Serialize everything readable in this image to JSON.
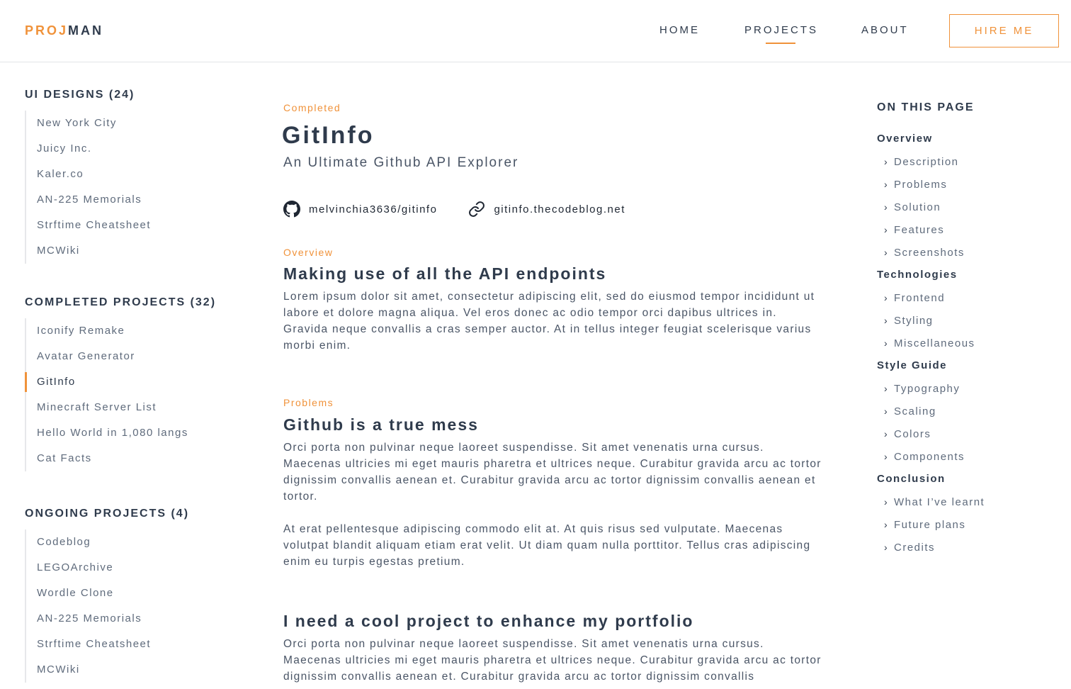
{
  "header": {
    "logo_accent": "PROJ",
    "logo_rest": "MAN",
    "nav": [
      {
        "label": "HOME"
      },
      {
        "label": "PROJECTS"
      },
      {
        "label": "ABOUT"
      }
    ],
    "active_nav": "PROJECTS",
    "hire_label": "HIRE ME"
  },
  "colors": {
    "accent": "#f0923a",
    "text_dark": "#2f3b4c",
    "text_muted": "#5f6b7c"
  },
  "sidebar": {
    "sections": [
      {
        "heading": "UI DESIGNS (24)",
        "items": [
          "New York City",
          "Juicy Inc.",
          "Kaler.co",
          "AN-225 Memorials",
          "Strftime Cheatsheet",
          "MCWiki"
        ]
      },
      {
        "heading": "COMPLETED PROJECTS (32)",
        "items": [
          "Iconify Remake",
          "Avatar Generator",
          "GitInfo",
          "Minecraft Server List",
          "Hello World in 1,080 langs",
          "Cat Facts"
        ]
      },
      {
        "heading": "ONGOING PROJECTS (4)",
        "items": [
          "Codeblog",
          "LEGOArchive",
          "Wordle Clone",
          "AN-225 Memorials",
          "Strftime Cheatsheet",
          "MCWiki"
        ]
      }
    ],
    "active_item": "GitInfo"
  },
  "main": {
    "status": "Completed",
    "title": "GitInfo",
    "subtitle": "An Ultimate Github API Explorer",
    "links": [
      {
        "icon": "github-icon",
        "label": "melvinchia3636/gitinfo"
      },
      {
        "icon": "link-icon",
        "label": "gitinfo.thecodeblog.net"
      }
    ],
    "sections": [
      {
        "kicker": "Overview",
        "title": "Making use of all the API endpoints",
        "paragraphs": [
          "Lorem ipsum dolor sit amet, consectetur adipiscing elit, sed do eiusmod tempor incididunt ut labore et dolore magna aliqua. Vel eros donec ac odio tempor orci dapibus ultrices in. Gravida neque convallis a cras semper auctor. At in tellus integer feugiat scelerisque varius morbi enim."
        ]
      },
      {
        "kicker": "Problems",
        "title": "Github is a true mess",
        "paragraphs": [
          "Orci porta non pulvinar neque laoreet suspendisse. Sit amet venenatis urna cursus. Maecenas ultricies mi eget mauris pharetra et ultrices neque. Curabitur gravida arcu ac tortor dignissim convallis aenean et. Curabitur gravida arcu ac tortor dignissim convallis aenean et tortor.",
          "At erat pellentesque adipiscing commodo elit at. At quis risus sed vulputate. Maecenas volutpat blandit aliquam etiam erat velit. Ut diam quam nulla porttitor. Tellus cras adipiscing enim eu turpis egestas pretium."
        ]
      },
      {
        "kicker": "",
        "title": "I need a cool project to enhance my portfolio",
        "paragraphs": [
          "Orci porta non pulvinar neque laoreet suspendisse. Sit amet venenatis urna cursus. Maecenas ultricies mi eget mauris pharetra et ultrices neque. Curabitur gravida arcu ac tortor dignissim convallis aenean et. Curabitur gravida arcu ac tortor dignissim convallis"
        ]
      }
    ]
  },
  "toc": {
    "heading": "ON THIS PAGE",
    "groups": [
      {
        "label": "Overview",
        "items": [
          "Description",
          "Problems",
          "Solution",
          "Features",
          "Screenshots"
        ]
      },
      {
        "label": "Technologies",
        "items": [
          "Frontend",
          "Styling",
          "Miscellaneous"
        ]
      },
      {
        "label": "Style Guide",
        "items": [
          "Typography",
          "Scaling",
          "Colors",
          "Components"
        ]
      },
      {
        "label": "Conclusion",
        "items": [
          "What I’ve learnt",
          "Future plans",
          "Credits"
        ]
      }
    ]
  }
}
